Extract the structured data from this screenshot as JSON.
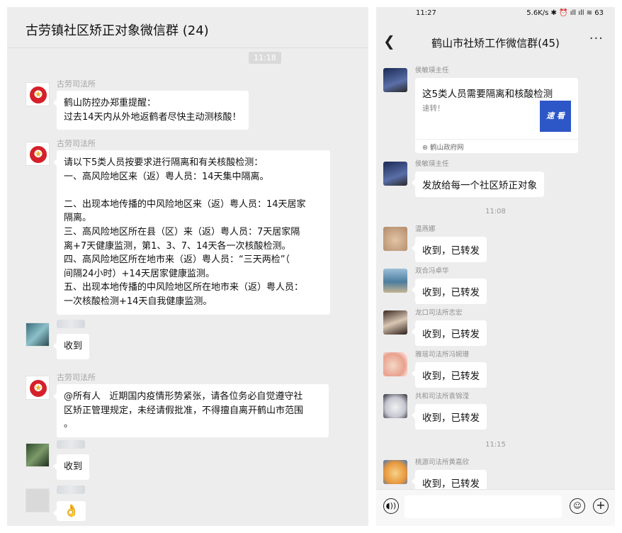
{
  "left": {
    "title": "古劳镇社区矫正对象微信群 (24)",
    "time": "11:18",
    "messages": [
      {
        "sender": "古劳司法所",
        "text": "鹤山防控办郑重提醒：\n过去14天内从外地返鹤者尽快主动测核酸！"
      },
      {
        "sender": "古劳司法所",
        "text": "请以下5类人员按要求进行隔离和有关核酸检测：\n一、高风险地区来（返）粤人员：14天集中隔离。\n\n二、出现本地传播的中风险地区来（返）粤人员：14天居家\n隔离。\n三、高风险地区所在县（区）来（返）粤人员：7天居家隔\n离+7天健康监测，第1、3、7、14天各一次核酸检测。\n四、高风险地区所在地市来（返）粤人员：“三天两检”（\n间隔24小时）+14天居家健康监测。\n五、出现本地传播的中风险地区所在地市来（返）粤人员：\n一次核酸检测+14天自我健康监测。"
      },
      {
        "sender": "",
        "text": "收到"
      },
      {
        "sender": "古劳司法所",
        "text": "@所有人   近期国内疫情形势紧张，请各位务必自觉遵守社\n区矫正管理规定，未经请假批准，不得擅自离开鹤山市范围\n。"
      },
      {
        "sender": "",
        "text": "收到"
      },
      {
        "sender": "",
        "text": "👌"
      }
    ]
  },
  "right": {
    "status_time": "11:27",
    "status_right": "5.6K/s ✱ ⏰ ıll ıll ≋ 63",
    "title": "鹤山市社矫工作微信群(45)",
    "more": "···",
    "card": {
      "sender": "侯敏瑛主任",
      "title": "这5类人员需要隔离和核酸检测",
      "subtitle": "速转！",
      "thumb_text": "速 看",
      "source": "鹤山政府网"
    },
    "msg2": {
      "sender": "侯敏瑛主任",
      "text": "发放给每一个社区矫正对象"
    },
    "time1": "11:08",
    "replies": [
      {
        "sender": "温燕娜",
        "text": "收到，已转发"
      },
      {
        "sender": "双合冯卓华",
        "text": "收到，已转发"
      },
      {
        "sender": "龙口司法所志宏",
        "text": "收到，已转发"
      },
      {
        "sender": "雅瑶司法所冯婉珊",
        "text": "收到，已转发"
      },
      {
        "sender": "共和司法所袁锦滢",
        "text": "收到，已转发"
      }
    ],
    "time2": "11:15",
    "last": {
      "sender": "桃源司法所黄嘉欣",
      "text": "收到，已转发"
    }
  }
}
